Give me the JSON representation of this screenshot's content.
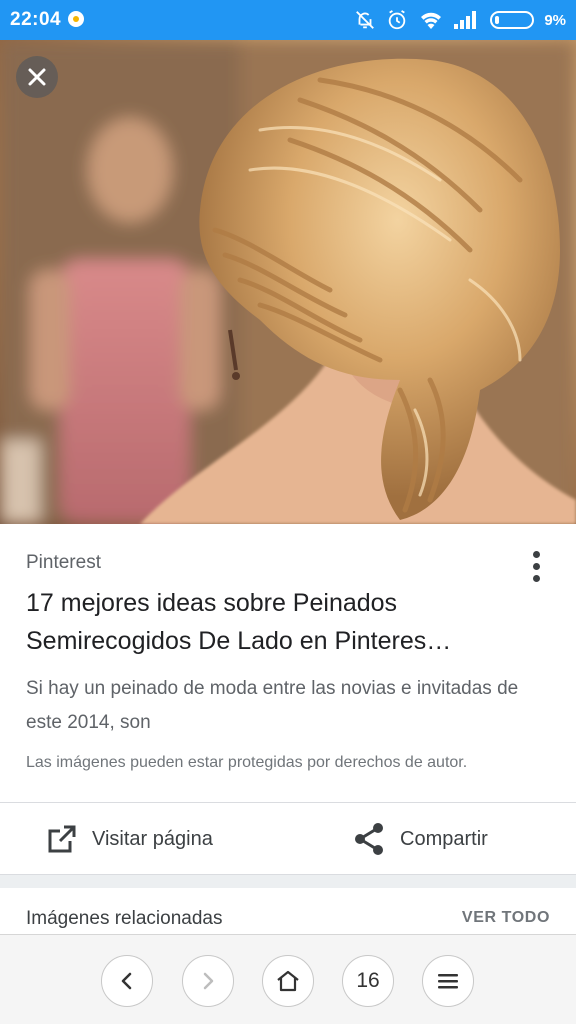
{
  "status_bar": {
    "time": "22:04",
    "battery": "9%"
  },
  "card": {
    "source": "Pinterest",
    "title": "17 mejores ideas sobre Peinados Semirecogidos De Lado en Pinteres…",
    "snippet": "Si hay un peinado de moda entre las novias e invitadas de este 2014, son",
    "copyright": "Las imágenes pueden estar protegidas por derechos de autor."
  },
  "actions": {
    "visit_label": "Visitar página",
    "share_label": "Compartir"
  },
  "related": {
    "title": "Imágenes relacionadas",
    "see_all": "VER TODO"
  },
  "browser_nav": {
    "tab_count": "16"
  },
  "colors": {
    "status_bar": "#2196f3",
    "text_primary": "#202124",
    "text_secondary": "#5f6368"
  }
}
